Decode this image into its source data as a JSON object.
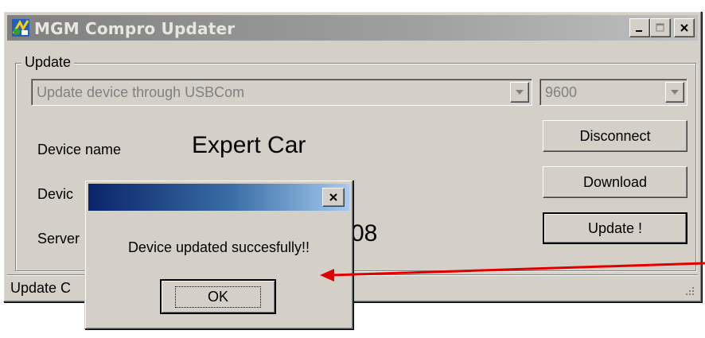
{
  "window": {
    "title": "MGM Compro Updater",
    "group_label": "Update",
    "device_combo": {
      "value": "Update device through USBCom"
    },
    "baud_combo": {
      "value": "9600"
    },
    "device_name_label": "Device name",
    "device_name_value": "Expert Car",
    "device_label_partial": "Devic",
    "server_label_partial": "Server",
    "server_value_partial": "08",
    "buttons": {
      "disconnect": "Disconnect",
      "download": "Download",
      "update": "Update !"
    },
    "status_partial": "Update C"
  },
  "dialog": {
    "message": "Device updated succesfully!!",
    "ok_label": "OK"
  },
  "colors": {
    "annotation_arrow": "#e00000",
    "dialog_title_start": "#0a246a",
    "dialog_title_end": "#a6caf0"
  }
}
